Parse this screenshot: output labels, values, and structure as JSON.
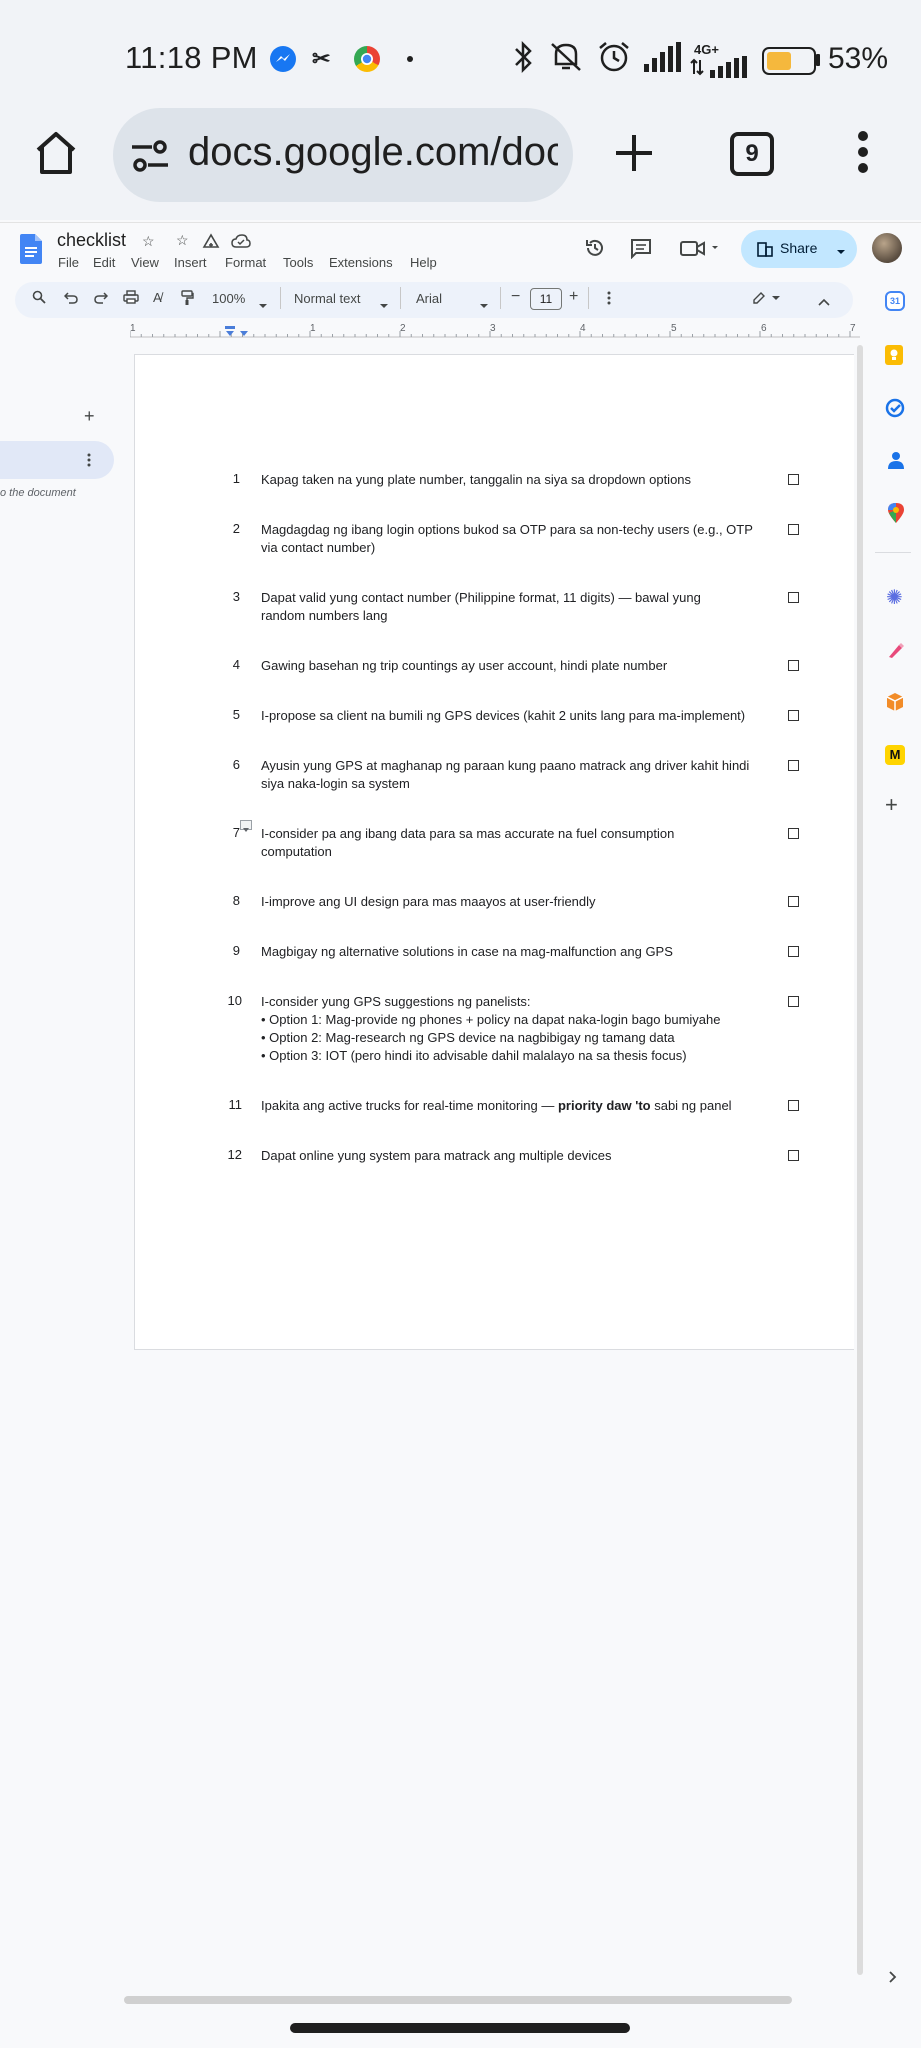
{
  "status_bar": {
    "time": "11:18 PM",
    "network": "4G+",
    "battery": "53%",
    "icons": [
      "messenger-icon",
      "capcut-icon",
      "chrome-icon",
      "dot-icon",
      "bluetooth-icon",
      "mute-icon",
      "alarm-icon",
      "signal-icon",
      "battery-icon"
    ]
  },
  "browser": {
    "url": "docs.google.com/doc",
    "tab_count": "9"
  },
  "doc": {
    "title": "checklist",
    "menu": [
      "File",
      "Edit",
      "View",
      "Insert",
      "Format",
      "Tools",
      "Extensions",
      "Help"
    ],
    "share_label": "Share"
  },
  "toolbar": {
    "zoom": "100%",
    "style": "Normal text",
    "font": "Arial",
    "font_size": "11"
  },
  "ruler": [
    "1",
    "1",
    "2",
    "3",
    "4",
    "5",
    "6",
    "7"
  ],
  "outline": {
    "hint": "o the document"
  },
  "checklist": [
    {
      "num": "1",
      "lines": [
        "Kapag taken na yung plate number, tanggalin na siya sa dropdown options"
      ]
    },
    {
      "num": "2",
      "lines": [
        "Magdagdag ng ibang login options bukod sa OTP para sa non-techy users (e.g., OTP",
        "via contact number)"
      ]
    },
    {
      "num": "3",
      "lines": [
        "Dapat valid yung contact number (Philippine format, 11 digits) — bawal yung",
        "random numbers lang"
      ]
    },
    {
      "num": "4",
      "lines": [
        "Gawing basehan ng trip countings ay user account, hindi plate number"
      ]
    },
    {
      "num": "5",
      "lines": [
        "I-propose sa client na bumili ng GPS devices (kahit 2 units lang para ma-implement)"
      ]
    },
    {
      "num": "6",
      "lines": [
        "Ayusin yung GPS at maghanap ng paraan kung paano matrack ang driver kahit hindi",
        "siya naka-login sa system"
      ]
    },
    {
      "num": "7",
      "lines": [
        "I-consider pa ang ibang data para sa mas accurate na fuel consumption",
        "computation"
      ]
    },
    {
      "num": "8",
      "lines": [
        "I-improve ang UI design para mas maayos at user-friendly"
      ]
    },
    {
      "num": "9",
      "lines": [
        "Magbigay ng alternative solutions in case na mag-malfunction ang GPS"
      ]
    },
    {
      "num": "10",
      "lines": [
        "I-consider yung GPS suggestions ng panelists:",
        "• Option 1: Mag-provide ng phones + policy na dapat naka-login bago bumiyahe",
        "• Option 2: Mag-research ng GPS device na nagbibigay ng tamang data",
        "• Option 3: IOT (pero hindi ito advisable dahil malalayo na sa thesis focus)"
      ]
    },
    {
      "num": "11",
      "lines": [
        "Ipakita ang active trucks for real-time monitoring — "
      ],
      "bold": "priority daw 'to",
      "tail": " sabi ng panel"
    },
    {
      "num": "12",
      "lines": [
        "Dapat online yung system para matrack ang multiple devices"
      ]
    }
  ]
}
